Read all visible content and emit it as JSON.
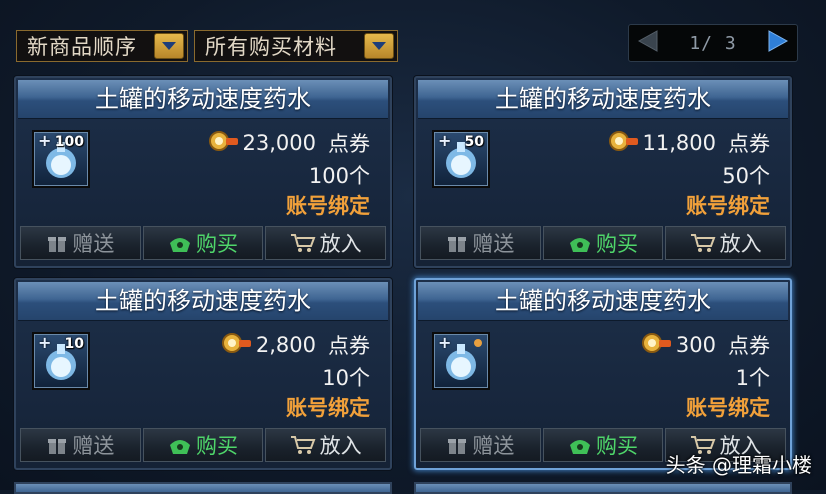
{
  "toolbar": {
    "sort_dropdown": "新商品顺序",
    "material_dropdown": "所有购买材料"
  },
  "pager": {
    "text": "1/ 3"
  },
  "items": [
    {
      "title": "土罐的移动速度药水",
      "qty_badge": "100",
      "price": "23,000",
      "currency": "点券",
      "count": "100个",
      "binding": "账号绑定",
      "gift": "赠送",
      "buy": "购买",
      "cart": "放入"
    },
    {
      "title": "土罐的移动速度药水",
      "qty_badge": "50",
      "price": "11,800",
      "currency": "点券",
      "count": "50个",
      "binding": "账号绑定",
      "gift": "赠送",
      "buy": "购买",
      "cart": "放入"
    },
    {
      "title": "土罐的移动速度药水",
      "qty_badge": "10",
      "price": "2,800",
      "currency": "点券",
      "count": "10个",
      "binding": "账号绑定",
      "gift": "赠送",
      "buy": "购买",
      "cart": "放入"
    },
    {
      "title": "土罐的移动速度药水",
      "qty_badge": "",
      "price": "300",
      "currency": "点券",
      "count": "1个",
      "binding": "账号绑定",
      "gift": "赠送",
      "buy": "购买",
      "cart": "放入"
    }
  ],
  "watermark": "头条 @理霜小楼",
  "colors": {
    "accent_gold": "#e6b94c",
    "title_bar_blue": "#3f6592",
    "bind_orange": "#f2a13a",
    "buy_green": "#4fd66a"
  },
  "icons": [
    "chevron-down-icon",
    "prev-page-icon",
    "next-page-icon",
    "potion-icon",
    "coin-icon",
    "gift-icon",
    "buy-icon",
    "cart-icon"
  ]
}
